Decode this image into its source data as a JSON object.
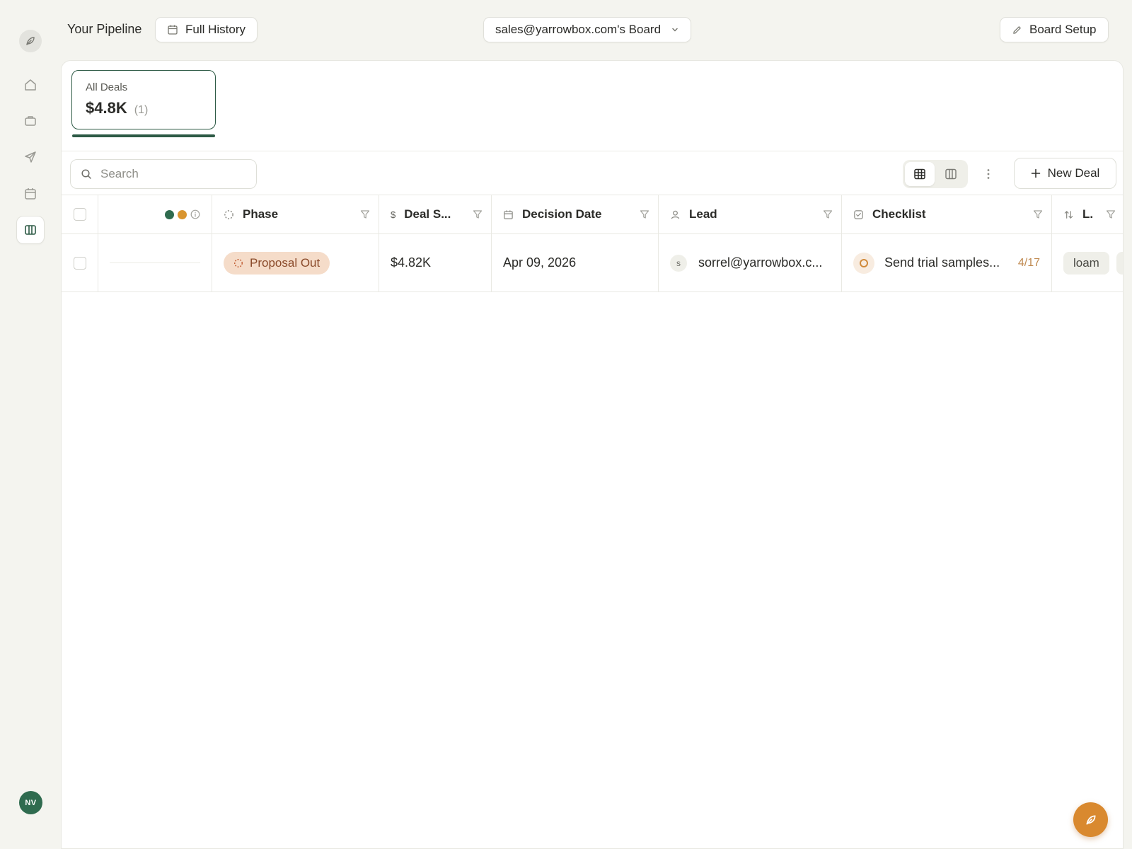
{
  "app": {
    "page_title": "Your Pipeline",
    "history_button": "Full History",
    "board_selector": "sales@yarrowbox.com's Board",
    "board_setup_button": "Board Setup"
  },
  "sidebar": {
    "logo_icon": "leaf-icon",
    "items": [
      {
        "name": "home",
        "icon": "home-icon",
        "active": false
      },
      {
        "name": "deals",
        "icon": "briefcase-icon",
        "active": false
      },
      {
        "name": "outreach",
        "icon": "send-icon",
        "active": false
      },
      {
        "name": "calendar",
        "icon": "calendar-icon",
        "active": false
      },
      {
        "name": "board",
        "icon": "board-icon",
        "active": true
      }
    ],
    "user_initials": "NV"
  },
  "summary": {
    "label": "All Deals",
    "value": "$4.8K",
    "count": "(1)"
  },
  "toolbar": {
    "search_placeholder": "Search",
    "view_options": [
      {
        "name": "table-view",
        "icon": "table-icon",
        "active": true
      },
      {
        "name": "board-view",
        "icon": "columns-icon",
        "active": false
      }
    ],
    "new_deal_label": "New Deal"
  },
  "table": {
    "status_dot_colors": [
      "#2f6b4f",
      "#d9952f"
    ],
    "columns": [
      {
        "key": "phase",
        "label": "Phase",
        "icon": "phase-icon"
      },
      {
        "key": "deal_size",
        "label": "Deal S...",
        "icon": "dollar-icon"
      },
      {
        "key": "decision_date",
        "label": "Decision Date",
        "icon": "calendar-icon"
      },
      {
        "key": "lead",
        "label": "Lead",
        "icon": "user-icon"
      },
      {
        "key": "checklist",
        "label": "Checklist",
        "icon": "checkbox-icon"
      },
      {
        "key": "labels",
        "label": "L.",
        "icon": "sort-icon"
      }
    ],
    "rows": [
      {
        "phase": "Proposal Out",
        "deal_size": "$4.82K",
        "decision_date": "Apr 09, 2026",
        "lead_initial": "s",
        "lead": "sorrel@yarrowbox.c...",
        "checklist_item": "Send trial samples...",
        "checklist_progress": "4/17",
        "tag": "loam"
      }
    ]
  },
  "colors": {
    "brand_green": "#2d5a45",
    "accent_orange": "#d9892f",
    "phase_badge_bg": "#f5dcc9"
  }
}
